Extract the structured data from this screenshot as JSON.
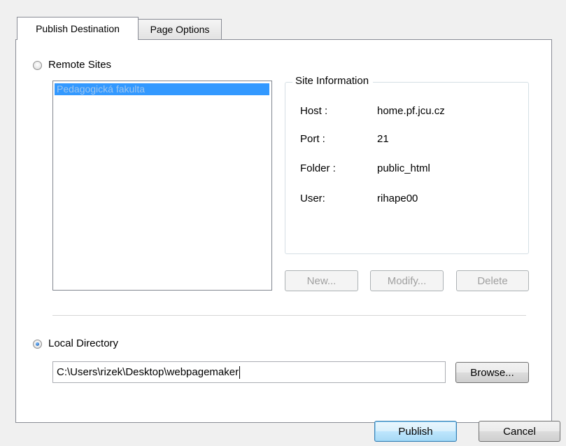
{
  "tabs": [
    {
      "label": "Publish Destination",
      "active": true
    },
    {
      "label": "Page Options",
      "active": false
    }
  ],
  "remote_sites": {
    "label": "Remote Sites",
    "selected": false,
    "list": [
      "Pedagogická fakulta"
    ]
  },
  "site_information": {
    "title": "Site Information",
    "host_label": "Host :",
    "host_value": "home.pf.jcu.cz",
    "port_label": "Port :",
    "port_value": "21",
    "folder_label": "Folder :",
    "folder_value": "public_html",
    "user_label": "User:",
    "user_value": "rihape00"
  },
  "site_buttons": {
    "new": "New...",
    "modify": "Modify...",
    "delete": "Delete"
  },
  "local_directory": {
    "label": "Local Directory",
    "selected": true,
    "path": "C:\\Users\\rizek\\Desktop\\webpagemaker",
    "browse": "Browse..."
  },
  "footer": {
    "publish": "Publish",
    "cancel": "Cancel"
  },
  "colors": {
    "selection": "#3399ff",
    "dialog_bg": "#f0f0f0",
    "default_button_border": "#3c7fb1"
  }
}
